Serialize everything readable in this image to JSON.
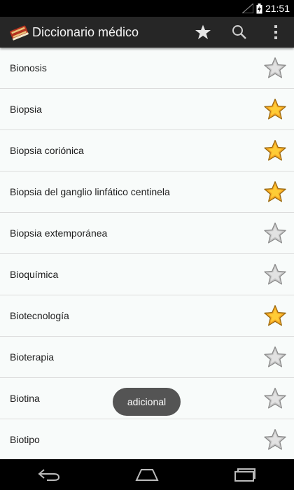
{
  "status_bar": {
    "time": "21:51",
    "signal_icon": "signal-icon",
    "battery_icon": "battery-charging-icon"
  },
  "action_bar": {
    "title": "Diccionario médico",
    "app_icon": "book-icon",
    "actions": [
      "favorites-star-icon",
      "search-icon",
      "overflow-menu-icon"
    ]
  },
  "list": {
    "items": [
      {
        "label": "Bionosis",
        "favorite": false
      },
      {
        "label": "Biopsia",
        "favorite": true
      },
      {
        "label": "Biopsia coriónica",
        "favorite": true
      },
      {
        "label": "Biopsia del ganglio linfático centinela",
        "favorite": true
      },
      {
        "label": "Biopsia extemporánea",
        "favorite": false
      },
      {
        "label": "Bioquímica",
        "favorite": false
      },
      {
        "label": "Biotecnología",
        "favorite": true
      },
      {
        "label": "Bioterapia",
        "favorite": false
      },
      {
        "label": "Biotina",
        "favorite": false
      },
      {
        "label": "Biotipo",
        "favorite": false
      }
    ]
  },
  "toast": {
    "text": "adicional"
  },
  "colors": {
    "star_on": "#f5a623",
    "star_off": "#c8c8c8",
    "action_bar": "#262626",
    "list_bg": "#f8fbfa"
  },
  "nav_bar": {
    "buttons": [
      "back-icon",
      "home-icon",
      "recent-apps-icon"
    ]
  }
}
